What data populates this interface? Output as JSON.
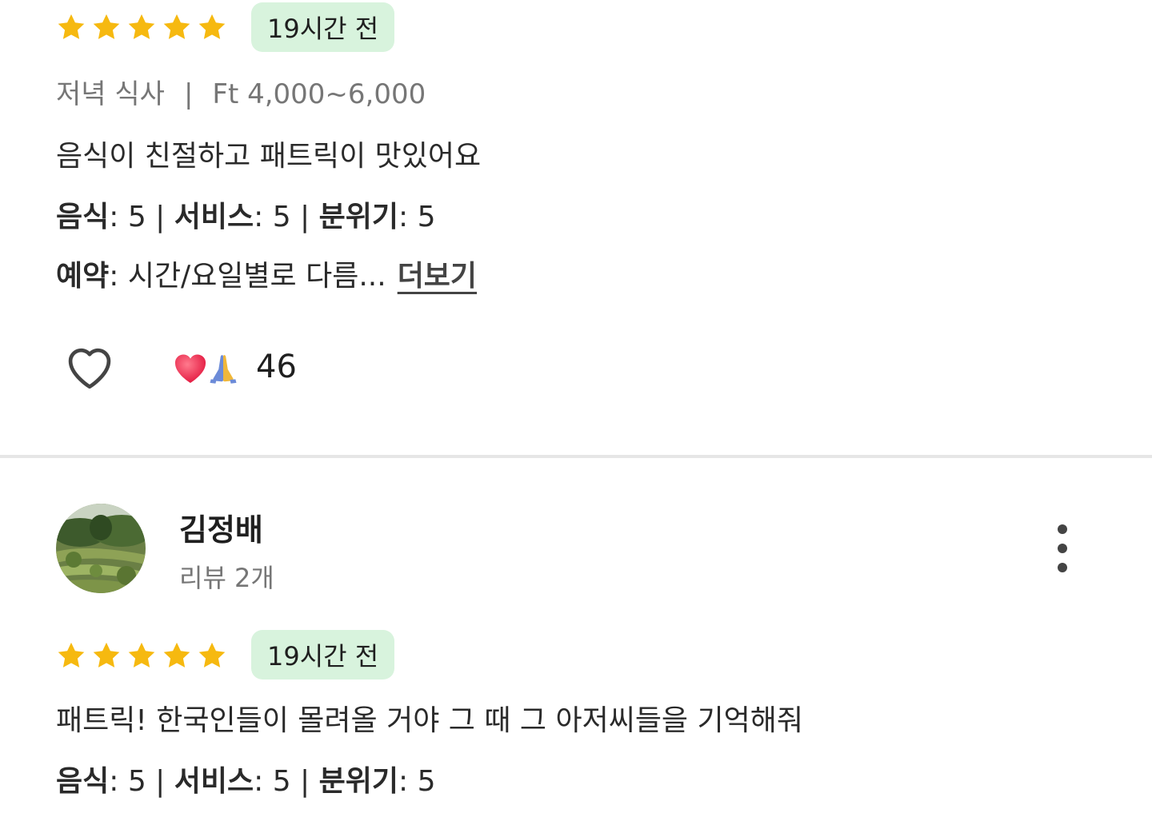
{
  "review1": {
    "rating": 5,
    "time_ago": "19시간 전",
    "meal_type": "저녁 식사",
    "price_range": "Ft 4,000~6,000",
    "text": "음식이 친절하고 패트릭이 맛있어요",
    "scores": {
      "food_label": "음식",
      "food_value": ": 5 | ",
      "service_label": "서비스",
      "service_value": ": 5 | ",
      "atmosphere_label": "분위기",
      "atmosphere_value": ": 5"
    },
    "reservation": {
      "label": "예약",
      "value": ": 시간/요일별로 다름...",
      "more_label": "더보기"
    },
    "reactions": {
      "emojis": "❤️🙏",
      "count": "46"
    }
  },
  "review2": {
    "user": {
      "name": "김정배",
      "review_count": "리뷰 2개"
    },
    "rating": 5,
    "time_ago": "19시간 전",
    "text": "패트릭! 한국인들이 몰려올 거야  그 때 그 아저씨들을 기억해줘",
    "scores": {
      "food_label": "음식",
      "food_value": ": 5 | ",
      "service_label": "서비스",
      "service_value": ": 5 | ",
      "atmosphere_label": "분위기",
      "atmosphere_value": ": 5"
    }
  },
  "colors": {
    "star": "#f6b910",
    "badge_bg": "#d8f3dd",
    "divider": "#e6e6e6",
    "muted_text": "#767676"
  },
  "icons": {
    "star": "star-icon",
    "heart": "heart-outline-icon",
    "more": "more-vertical-icon"
  }
}
